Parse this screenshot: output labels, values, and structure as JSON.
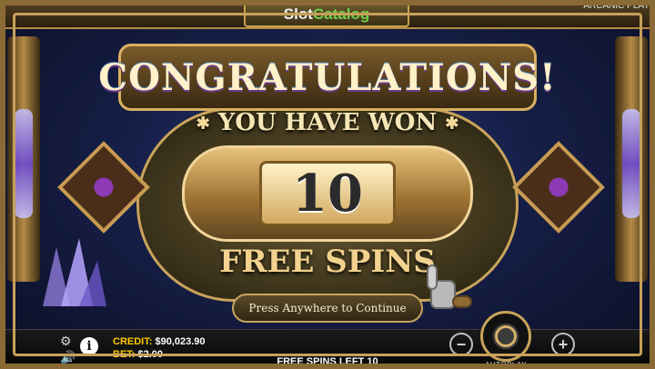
{
  "brand": {
    "left": "Slot",
    "right": "Catalog"
  },
  "game": {
    "name": "ARCANIC PLAY"
  },
  "popup": {
    "title": "CONGRATULATIONS!",
    "you_have_won": "YOU HAVE WON",
    "number": "10",
    "free_spins": "FREE SPINS",
    "continue_label": "Press Anywhere to Continue"
  },
  "bottom": {
    "credit_label": "CREDIT:",
    "credit_value": "$90,023.90",
    "bet_label": "BET:",
    "bet_value": "$2.00",
    "free_spins_left": "FREE SPINS LEFT 10",
    "info_label": "i",
    "autoplay_label": "AUTOPLAY",
    "minus_label": "−",
    "plus_label": "+"
  },
  "icons": [
    "gear-icon",
    "info-icon",
    "sound-icon",
    "wheel-icon"
  ]
}
